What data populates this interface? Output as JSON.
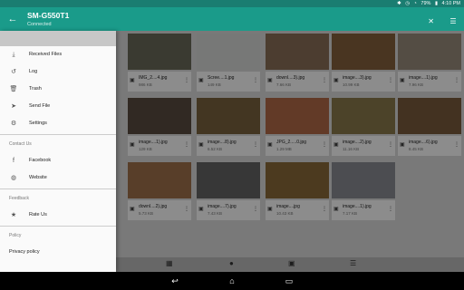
{
  "status_bar": {
    "left": "",
    "battery": "79%",
    "time": "4:10 PM",
    "icons": [
      "bluetooth-icon",
      "alarm-icon",
      "wifi-icon",
      "battery-icon"
    ]
  },
  "app_bar": {
    "title": "SM-G550T1",
    "subtitle": "Connected",
    "icons": [
      "back-icon",
      "bluetooth-off-icon",
      "list-view-icon"
    ]
  },
  "drawer": {
    "items": [
      {
        "label": "Received Files",
        "icon": "download-icon"
      },
      {
        "label": "Log",
        "icon": "history-icon"
      },
      {
        "label": "Trash",
        "icon": "trash-icon"
      },
      {
        "label": "Send File",
        "icon": "send-icon"
      },
      {
        "label": "Settings",
        "icon": "settings-icon"
      }
    ],
    "contact_title": "Contact Us",
    "contact_items": [
      {
        "label": "Facebook",
        "icon": "facebook-icon"
      },
      {
        "label": "Website",
        "icon": "globe-icon"
      }
    ],
    "feedback_title": "Feedback",
    "feedback_items": [
      {
        "label": "Rate Us",
        "icon": "star-icon"
      }
    ],
    "policy_title": "Policy",
    "policy_items": [
      {
        "label": "Privacy policy"
      }
    ]
  },
  "tiles": [
    {
      "name": "IMG_2....4.jpg",
      "size": "986 KB",
      "color": "#6b6b5a"
    },
    {
      "name": "Scree....1.jpg",
      "size": "149 KB",
      "color": "#d9dbd9"
    },
    {
      "name": "downl....3).jpg",
      "size": "7.66 KB",
      "color": "#8a6f58"
    },
    {
      "name": "image....3).jpg",
      "size": "10.99 KB",
      "color": "#86623c"
    },
    {
      "name": "image....1).jpg",
      "size": "7.96 KB",
      "color": "#9a8c7d"
    },
    {
      "name": "image....1).jpg",
      "size": "129 KB",
      "color": "#594c40"
    },
    {
      "name": "image....8).jpg",
      "size": "6.52 KB",
      "color": "#7a633f"
    },
    {
      "name": "JPG_2.....0.jpg",
      "size": "1.29 MB",
      "color": "#b36a48"
    },
    {
      "name": "image....2).jpg",
      "size": "11.16 KB",
      "color": "#8b7a4c"
    },
    {
      "name": "image....6).jpg",
      "size": "8.45 KB",
      "color": "#7a5b3d"
    },
    {
      "name": "downl....2).jpg",
      "size": "5.73 KB",
      "color": "#a0724c"
    },
    {
      "name": "image....7).jpg",
      "size": "7.43 KB",
      "color": "#646464"
    },
    {
      "name": "image....jpg",
      "size": "10.43 KB",
      "color": "#8b6a3a"
    },
    {
      "name": "image....1).jpg",
      "size": "7.17 KB",
      "color": "#8a8c94"
    }
  ],
  "bottom_bar": {
    "icons": [
      "photos-icon",
      "person-icon",
      "gallery-icon",
      "list-icon"
    ]
  }
}
